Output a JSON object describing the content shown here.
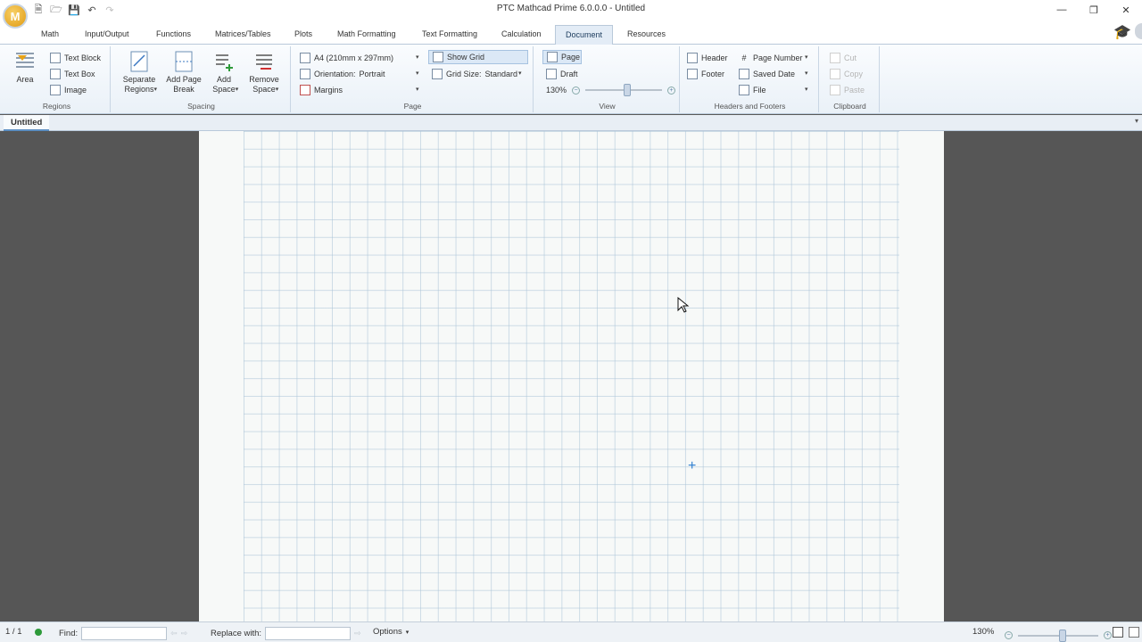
{
  "titlebar": {
    "app_logo": "M",
    "title": "PTC Mathcad Prime 6.0.0.0 - Untitled",
    "qat_icons": [
      "new-document-icon",
      "open-folder-icon",
      "save-icon",
      "undo-icon",
      "redo-icon"
    ],
    "window_controls": [
      "minimize-icon",
      "restore-icon",
      "close-icon"
    ]
  },
  "tabs": [
    {
      "label": "Math"
    },
    {
      "label": "Input/Output"
    },
    {
      "label": "Functions"
    },
    {
      "label": "Matrices/Tables"
    },
    {
      "label": "Plots"
    },
    {
      "label": "Math Formatting"
    },
    {
      "label": "Text Formatting"
    },
    {
      "label": "Calculation"
    },
    {
      "label": "Document",
      "active": true
    },
    {
      "label": "Resources"
    }
  ],
  "ribbon": {
    "regions": {
      "label": "Regions",
      "area": "Area",
      "text_block": "Text Block",
      "text_box": "Text Box",
      "image": "Image"
    },
    "spacing": {
      "label": "Spacing",
      "separate_regions_1": "Separate",
      "separate_regions_2": "Regions",
      "add_page_break_1": "Add Page",
      "add_page_break_2": "Break",
      "add_space_1": "Add",
      "add_space_2": "Space",
      "remove_space_1": "Remove",
      "remove_space_2": "Space"
    },
    "page": {
      "label": "Page",
      "paper_size": "A4 (210mm x 297mm)",
      "orientation_label": "Orientation:",
      "orientation_value": "Portrait",
      "margins": "Margins",
      "show_grid": "Show Grid",
      "grid_size_label": "Grid Size:",
      "grid_size_value": "Standard"
    },
    "view": {
      "label": "View",
      "page": "Page",
      "draft": "Draft",
      "zoom": "130%",
      "zoom_level": 0.55
    },
    "headers_footers": {
      "label": "Headers and Footers",
      "header": "Header",
      "footer": "Footer",
      "page_number": "Page Number",
      "saved_date": "Saved Date",
      "file": "File"
    },
    "clipboard": {
      "label": "Clipboard",
      "cut": "Cut",
      "copy": "Copy",
      "paste": "Paste"
    }
  },
  "document_tab": {
    "label": "Untitled"
  },
  "statusbar": {
    "page_indicator": "1 / 1",
    "find_label": "Find:",
    "find_value": "",
    "replace_label": "Replace with:",
    "replace_value": "",
    "options_label": "Options",
    "zoom": "130%",
    "zoom_level": 0.55
  },
  "colors": {
    "accent": "#5b8ec2",
    "canvas_bg": "#565656",
    "page_bg": "#f7f9f8",
    "grid_line": "#aac3d7",
    "crosshair": "#2f7fd0",
    "status_ok": "#2e9a3a"
  }
}
